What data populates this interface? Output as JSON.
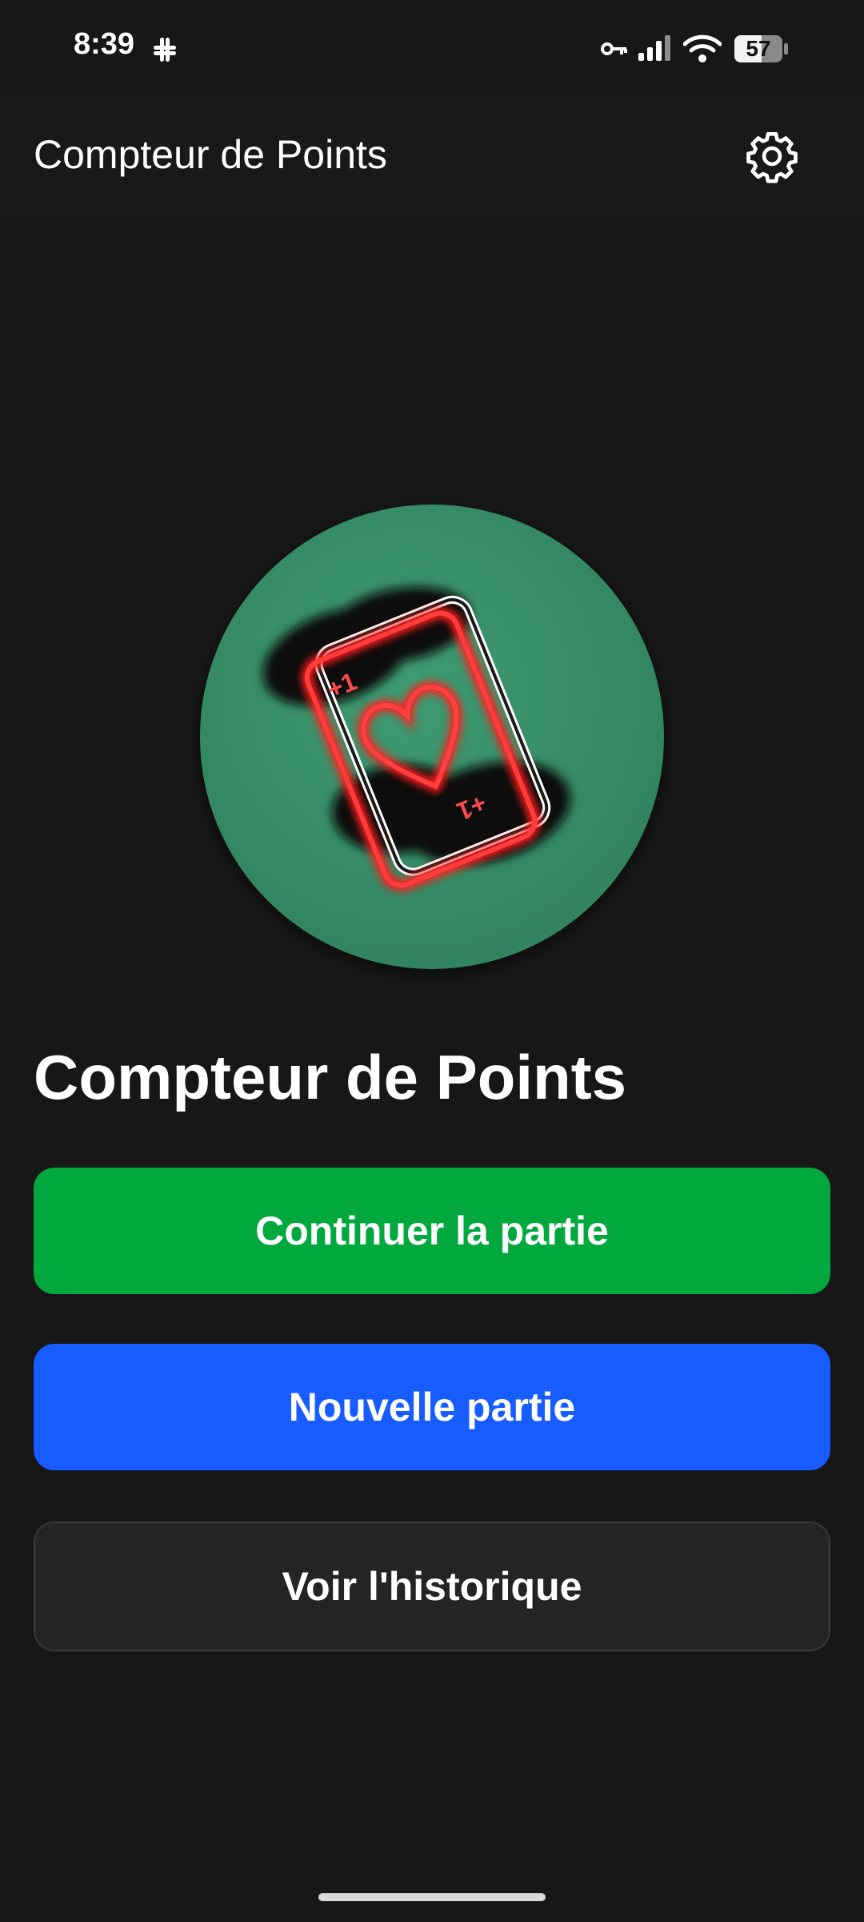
{
  "status_bar": {
    "time": "8:39",
    "battery": {
      "text": "57",
      "level": 0.57
    },
    "icons": [
      "slack-icon",
      "key-icon",
      "signal-icon",
      "wifi-icon",
      "battery-icon"
    ]
  },
  "app_bar": {
    "title": "Compteur de Points",
    "settings_icon": "gear-icon"
  },
  "hero": {
    "logo_icon": "playing-card-heart-icon",
    "card_corner_label": "+1",
    "title": "Compteur de Points"
  },
  "buttons": {
    "continue_label": "Continuer la partie",
    "new_game_label": "Nouvelle partie",
    "history_label": "Voir l'historique"
  },
  "colors": {
    "background": "#171718",
    "continue": "#00a83e",
    "new_game": "#175cff",
    "history": "#242425",
    "logo_circle": "#3a8f68",
    "neon": "#ff1a1a"
  }
}
